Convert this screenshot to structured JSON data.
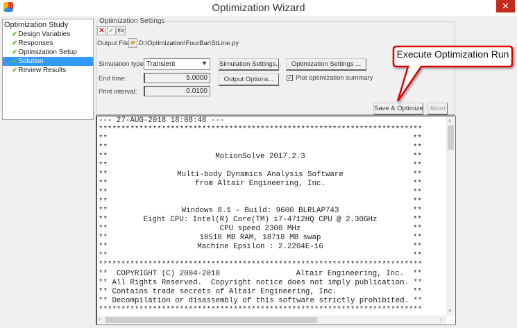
{
  "window": {
    "title": "Optimization Wizard",
    "close_label": "✕"
  },
  "tree": {
    "root": "Optimization Study",
    "items": [
      {
        "label": "Design Variables",
        "done": true
      },
      {
        "label": "Responses",
        "done": true
      },
      {
        "label": "Optimization Setup",
        "done": true
      },
      {
        "label": "Solution",
        "done": true,
        "selected": true
      },
      {
        "label": "Review Results",
        "done": true
      }
    ],
    "check_glyph": "✔"
  },
  "settings": {
    "group_label": "Optimization Settings",
    "toolbar": {
      "cancel": "✕",
      "apply": "✓",
      "expression": "f(x)"
    },
    "output_file_label": "Output File:",
    "output_file_value": "D:\\Optimization\\FourBar\\StLine.py",
    "simulation_type_label": "Simulation type:",
    "simulation_type_value": "Transient",
    "end_time_label": "End time:",
    "end_time_value": "5.0000",
    "print_interval_label": "Print interval:",
    "print_interval_value": "0.0100",
    "simulation_settings_button": "Simulation Settings...",
    "output_options_button": "Output Options...",
    "optimization_settings_button": "Optimization Settings ...",
    "plot_summary_label": "Plot optimization summary",
    "plot_summary_checked": true,
    "save_optimize_button": "Save & Optimize",
    "abort_button": "Abort"
  },
  "callout": {
    "text": "Execute Optimization Run",
    "color": "#e00000"
  },
  "log": {
    "border": "**",
    "lines": [
      {
        "type": "plain",
        "text": "--- 27-AUG-2018 18:08:48 ---"
      },
      {
        "type": "plain",
        "text": "************************************************************************"
      },
      {
        "type": "frame",
        "text": ""
      },
      {
        "type": "frame",
        "text": ""
      },
      {
        "type": "frame",
        "text": "MotionSolve 2017.2.3"
      },
      {
        "type": "frame",
        "text": ""
      },
      {
        "type": "frame",
        "text": "Multi-body Dynamics Analysis Software"
      },
      {
        "type": "frame",
        "text": "from Altair Engineering, Inc."
      },
      {
        "type": "frame",
        "text": ""
      },
      {
        "type": "frame",
        "text": ""
      },
      {
        "type": "frame",
        "text": "Windows 8.1 - Build: 9600 BLRLAP743"
      },
      {
        "type": "frame",
        "text": "Eight CPU: Intel(R) Core(TM) i7-4712HQ CPU @ 2.30GHz"
      },
      {
        "type": "frame",
        "text": "CPU speed 2300 MHz"
      },
      {
        "type": "frame",
        "text": "10518 MB RAM, 18718 MB swap"
      },
      {
        "type": "frame",
        "text": "Machine Epsilon : 2.2204E-16"
      },
      {
        "type": "frame",
        "text": ""
      },
      {
        "type": "plain",
        "text": "************************************************************************"
      },
      {
        "type": "split",
        "left": "  COPYRIGHT (C) 2004-2018",
        "right": "Altair Engineering, Inc.  "
      },
      {
        "type": "split",
        "left": " All Rights Reserved.  Copyright notice does not imply publication. ",
        "right": ""
      },
      {
        "type": "split",
        "left": " Contains trade secrets of Altair Engineering, Inc.",
        "right": ""
      },
      {
        "type": "split",
        "left": " Decompilation or disassembly of this software strictly prohibited. ",
        "right": ""
      },
      {
        "type": "plain",
        "text": "************************************************************************"
      }
    ]
  }
}
